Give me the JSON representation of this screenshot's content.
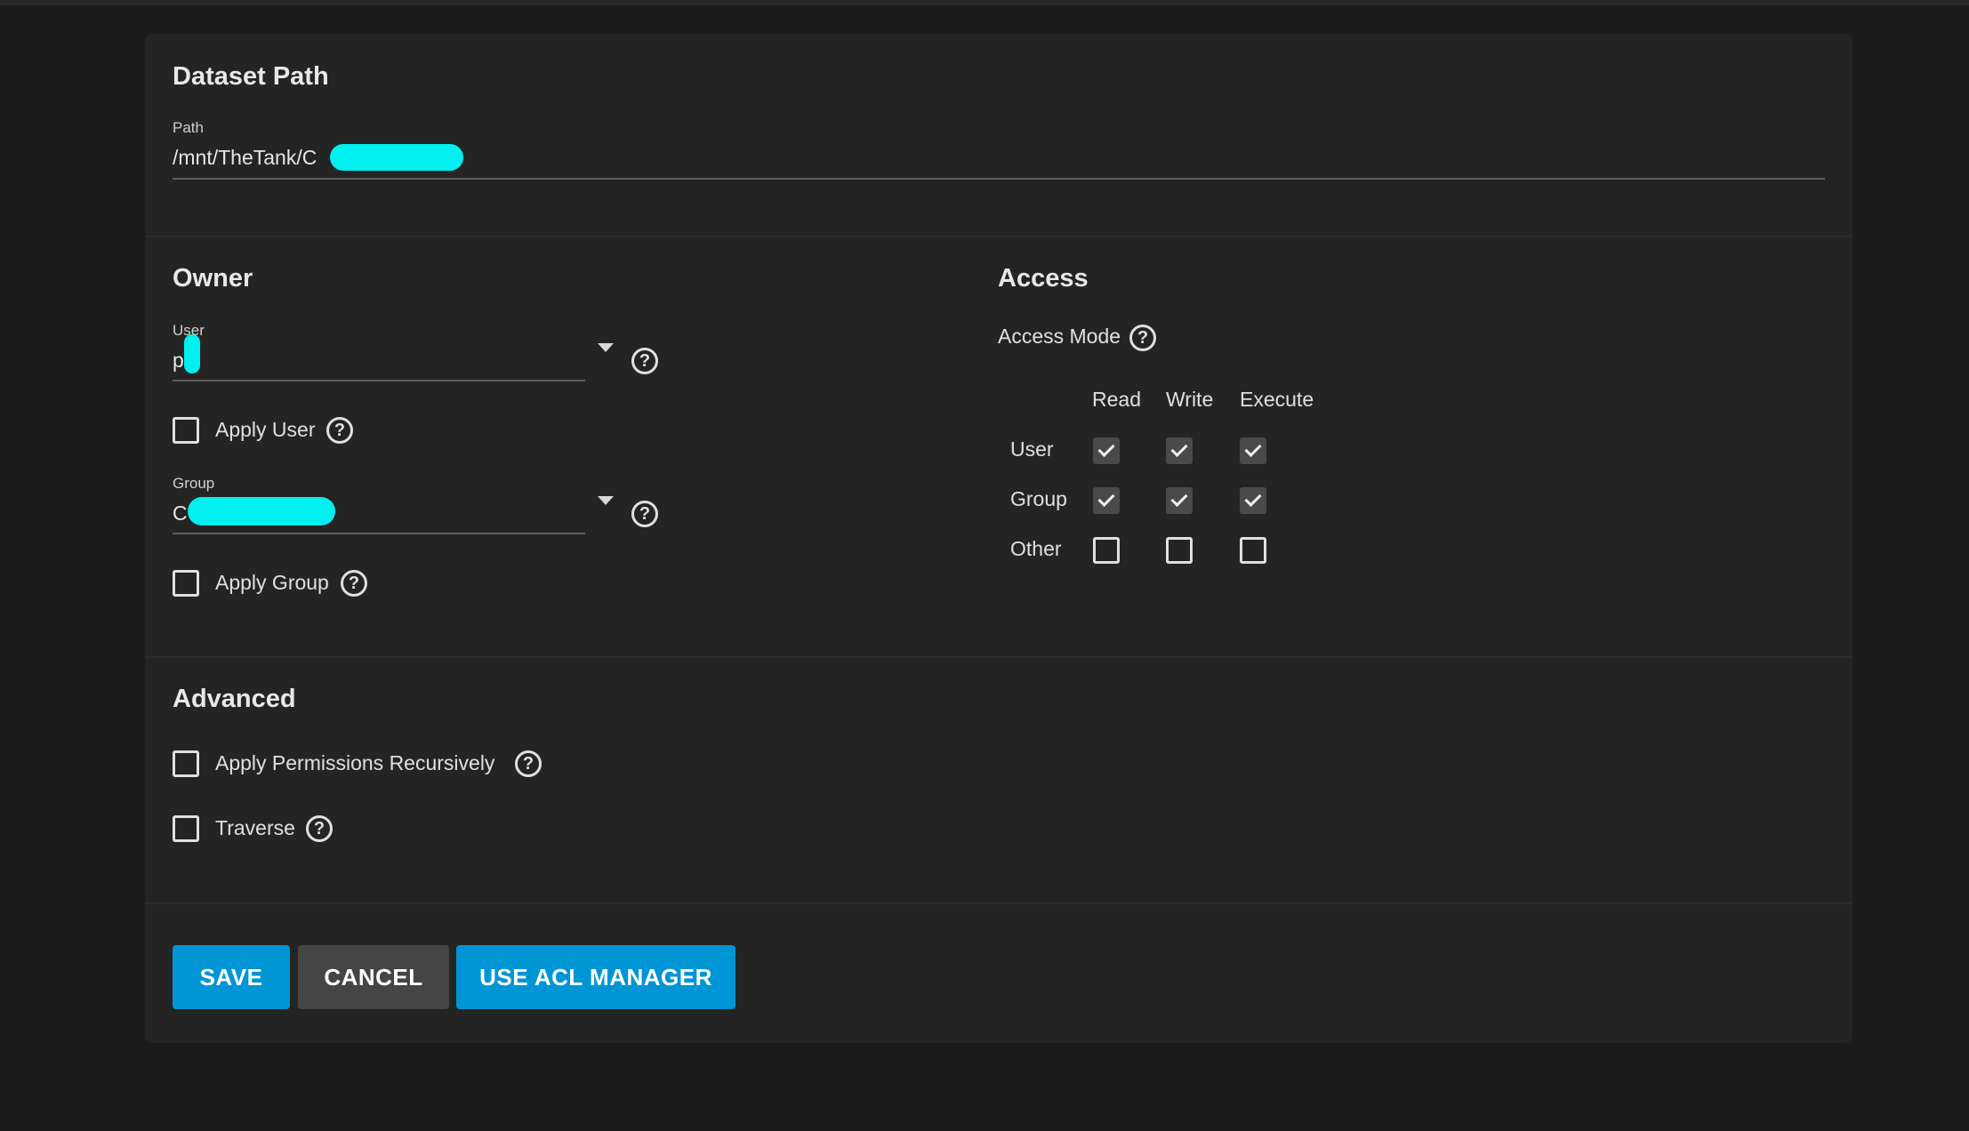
{
  "dataset": {
    "title": "Dataset Path",
    "path_label": "Path",
    "path_value": "/mnt/TheTank/C"
  },
  "owner": {
    "title": "Owner",
    "user_label": "User",
    "user_value": "p",
    "apply_user_label": "Apply User",
    "group_label": "Group",
    "group_value": "C",
    "apply_group_label": "Apply Group"
  },
  "access": {
    "title": "Access",
    "mode_label": "Access Mode",
    "columns": [
      "Read",
      "Write",
      "Execute"
    ],
    "rows": [
      {
        "label": "User",
        "values": [
          true,
          true,
          true
        ]
      },
      {
        "label": "Group",
        "values": [
          true,
          true,
          true
        ]
      },
      {
        "label": "Other",
        "values": [
          false,
          false,
          false
        ]
      }
    ]
  },
  "advanced": {
    "title": "Advanced",
    "recursive_label": "Apply Permissions Recursively",
    "traverse_label": "Traverse"
  },
  "buttons": {
    "save": "SAVE",
    "cancel": "CANCEL",
    "acl": "USE ACL MANAGER"
  },
  "icons": {
    "help": "?"
  },
  "colors": {
    "primary": "#0095d5",
    "secondary": "#454545",
    "card": "#242424",
    "background": "#1c1c1c"
  }
}
